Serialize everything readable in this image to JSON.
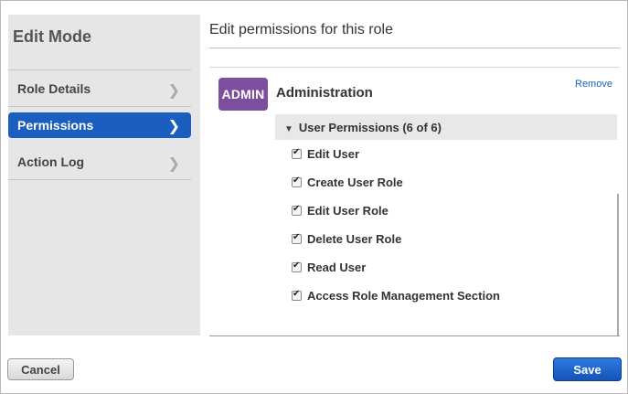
{
  "sidebar": {
    "title": "Edit Mode",
    "items": [
      {
        "label": "Role Details",
        "active": false
      },
      {
        "label": "Permissions",
        "active": true
      },
      {
        "label": "Action Log",
        "active": false
      }
    ]
  },
  "main": {
    "title": "Edit permissions for this role"
  },
  "role": {
    "badge": "ADMIN",
    "name": "Administration",
    "remove_label": "Remove",
    "badge_color": "#7b4f9e"
  },
  "permissions": {
    "group_label": "User Permissions (6 of 6)",
    "items": [
      {
        "label": "Edit User",
        "checked": true
      },
      {
        "label": "Create User Role",
        "checked": true
      },
      {
        "label": "Edit User Role",
        "checked": true
      },
      {
        "label": "Delete User Role",
        "checked": true
      },
      {
        "label": "Read User",
        "checked": true
      },
      {
        "label": "Access Role Management Section",
        "checked": true
      }
    ]
  },
  "footer": {
    "cancel_label": "Cancel",
    "save_label": "Save",
    "accent": "#1a5fbf"
  }
}
